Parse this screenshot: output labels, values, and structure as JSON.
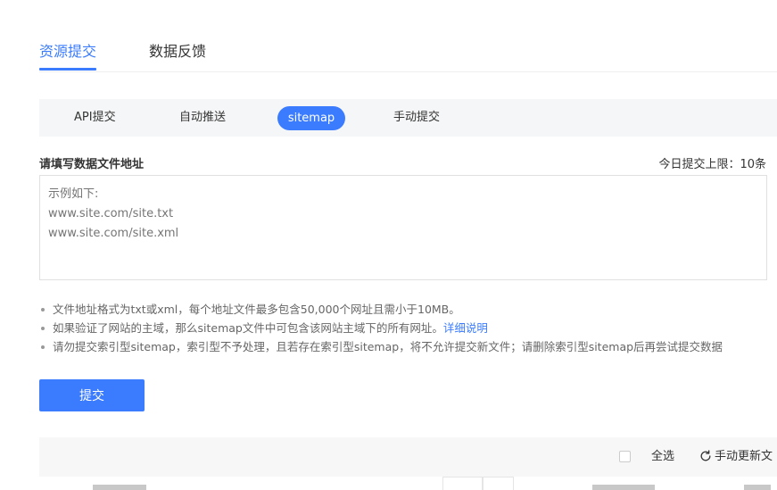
{
  "top_tabs": [
    {
      "label": "资源提交",
      "active": true
    },
    {
      "label": "数据反馈",
      "active": false
    }
  ],
  "sub_tabs": [
    {
      "label": "API提交",
      "active": false
    },
    {
      "label": "自动推送",
      "active": false
    },
    {
      "label": "sitemap",
      "active": true
    },
    {
      "label": "手动提交",
      "active": false
    }
  ],
  "form": {
    "label": "请填写数据文件地址",
    "limit": "今日提交上限：10条",
    "placeholder": "示例如下:\nwww.site.com/site.txt\nwww.site.com/site.xml",
    "value": ""
  },
  "notes": [
    {
      "text": "文件地址格式为txt或xml，每个地址文件最多包含50,000个网址且需小于10MB。"
    },
    {
      "text": "如果验证了网站的主域，那么sitemap文件中可包含该网站主域下的所有网址。",
      "link": "详细说明"
    },
    {
      "text": "请勿提交索引型sitemap，索引型不予处理，且若存在索引型sitemap，将不允许提交新文件；请删除索引型sitemap后再尝试提交数据"
    }
  ],
  "submit_label": "提交",
  "toolbar": {
    "select_all": "全选",
    "refresh_label": "手动更新文",
    "refresh_icon": "refresh-icon",
    "checkbox_checked": false
  },
  "colors": {
    "accent": "#3b7cff",
    "text": "#333333",
    "muted": "#666666",
    "placeholder": "#999999",
    "bar_bg": "#f5f6f7"
  }
}
